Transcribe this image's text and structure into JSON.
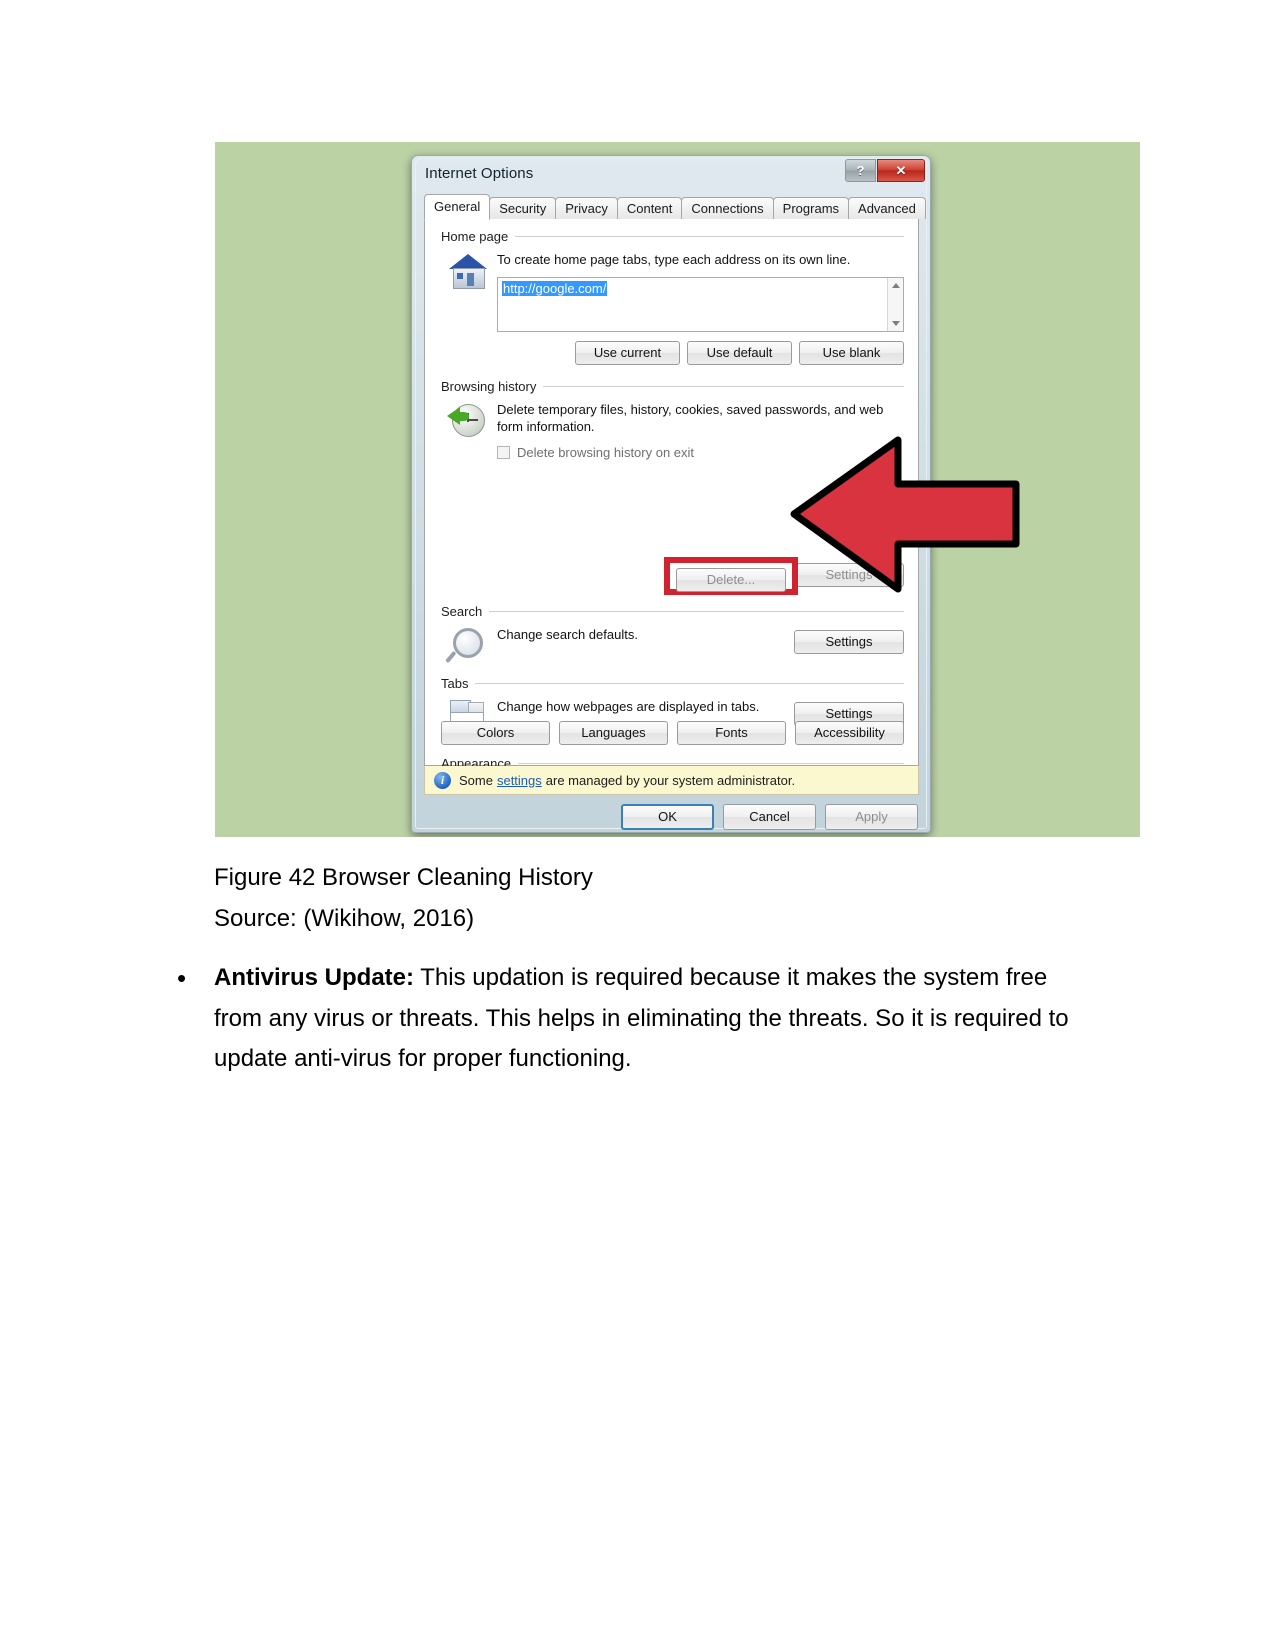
{
  "document": {
    "caption": "Figure 42 Browser Cleaning History",
    "source": "Source: (Wikihow, 2016)",
    "bullets": [
      {
        "marker": "•",
        "lead": "Antivirus Update:",
        "body": " This updation is required because it makes the system free from any virus or threats. This helps in eliminating the threats. So it is required to update anti-virus for proper functioning."
      }
    ]
  },
  "figure": {
    "background_color": "#bbd2a5",
    "annotation": {
      "arrow_color": "#d9333f",
      "arrow_outline": "#000000",
      "highlight_color": "#d1232f",
      "points_at": "Delete..."
    },
    "dialog": {
      "title": "Internet Options",
      "help_button": "?",
      "close_button": "✕",
      "tabs": [
        {
          "label": "General",
          "active": true
        },
        {
          "label": "Security",
          "active": false
        },
        {
          "label": "Privacy",
          "active": false
        },
        {
          "label": "Content",
          "active": false
        },
        {
          "label": "Connections",
          "active": false
        },
        {
          "label": "Programs",
          "active": false
        },
        {
          "label": "Advanced",
          "active": false
        }
      ],
      "home_page": {
        "group_label": "Home page",
        "icon": "house-icon",
        "description": "To create home page tabs, type each address on its own line.",
        "url_value": "http://google.com/",
        "buttons": [
          "Use current",
          "Use default",
          "Use blank"
        ]
      },
      "browsing_history": {
        "group_label": "Browsing history",
        "icon": "clock-refresh-icon",
        "description": "Delete temporary files, history, cookies, saved passwords, and web form information.",
        "checkbox_label": "Delete browsing history on exit",
        "checkbox_checked": false,
        "delete_button": "Delete...",
        "settings_button": "Settings"
      },
      "search": {
        "group_label": "Search",
        "icon": "magnifier-icon",
        "description": "Change search defaults.",
        "settings_button": "Settings"
      },
      "tabs_section": {
        "group_label": "Tabs",
        "icon": "browser-tabs-icon",
        "description": "Change how webpages are displayed in tabs.",
        "settings_button": "Settings"
      },
      "appearance": {
        "group_label": "Appearance",
        "buttons": [
          "Colors",
          "Languages",
          "Fonts",
          "Accessibility"
        ]
      },
      "admin_notice": {
        "icon": "info-icon",
        "prefix": "Some",
        "link": "settings",
        "suffix": "are managed by your system administrator."
      },
      "footer": {
        "ok": "OK",
        "cancel": "Cancel",
        "apply": "Apply"
      }
    }
  }
}
